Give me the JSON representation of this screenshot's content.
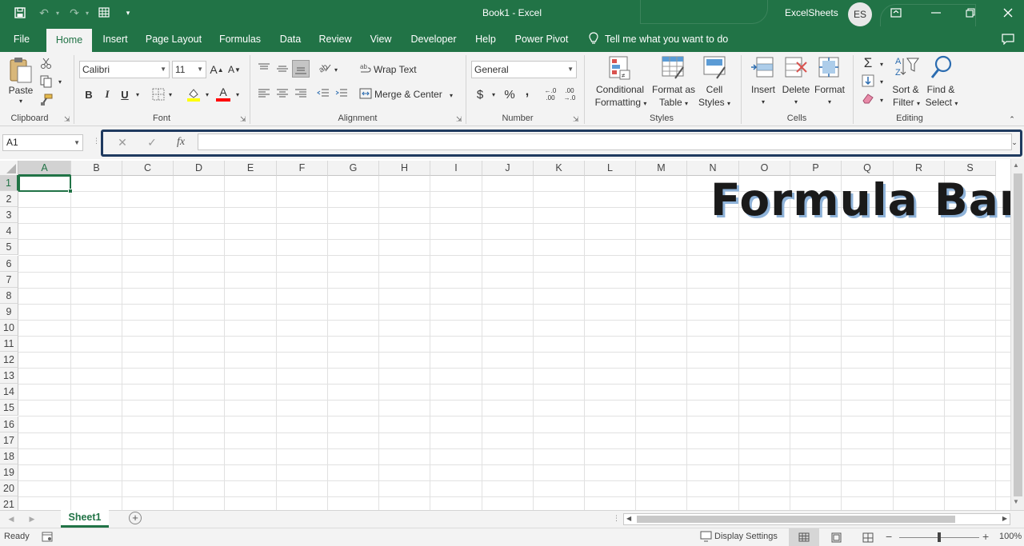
{
  "titlebar": {
    "title": "Book1  -  Excel",
    "user_name": "ExcelSheets",
    "user_initials": "ES"
  },
  "tabs": [
    "File",
    "Home",
    "Insert",
    "Page Layout",
    "Formulas",
    "Data",
    "Review",
    "View",
    "Developer",
    "Help",
    "Power Pivot"
  ],
  "tell_me": "Tell me what you want to do",
  "ribbon": {
    "clipboard": {
      "paste": "Paste",
      "label": "Clipboard"
    },
    "font": {
      "name": "Calibri",
      "size": "11",
      "bold": "B",
      "italic": "I",
      "underline": "U",
      "grow": "A",
      "shrink": "A",
      "color_letter": "A",
      "label": "Font"
    },
    "alignment": {
      "wrap_text": "Wrap Text",
      "merge_center": "Merge & Center",
      "label": "Alignment"
    },
    "number": {
      "format": "General",
      "currency": "$",
      "percent": "%",
      "comma": ",",
      "inc_decimal": "←.0 .00",
      "dec_decimal": ".00 →.0",
      "label": "Number"
    },
    "styles": {
      "conditional_1": "Conditional",
      "conditional_2": "Formatting",
      "format_table_1": "Format as",
      "format_table_2": "Table",
      "cell_styles_1": "Cell",
      "cell_styles_2": "Styles",
      "label": "Styles"
    },
    "cells": {
      "insert": "Insert",
      "delete": "Delete",
      "format": "Format",
      "label": "Cells"
    },
    "editing": {
      "sigma": "Σ",
      "sort_1": "Sort &",
      "sort_2": "Filter",
      "find_1": "Find &",
      "find_2": "Select",
      "label": "Editing"
    }
  },
  "formula_bar": {
    "name_box": "A1",
    "cancel": "✕",
    "enter": "✓",
    "fx": "fx",
    "value": ""
  },
  "grid": {
    "columns": [
      "A",
      "B",
      "C",
      "D",
      "E",
      "F",
      "G",
      "H",
      "I",
      "J",
      "K",
      "L",
      "M",
      "N",
      "O",
      "P",
      "Q",
      "R",
      "S"
    ],
    "rows": [
      "1",
      "2",
      "3",
      "4",
      "5",
      "6",
      "7",
      "8",
      "9",
      "10",
      "11",
      "12",
      "13",
      "14",
      "15",
      "16",
      "17",
      "18",
      "19",
      "20",
      "21"
    ],
    "selected_cell": "A1"
  },
  "overlay_text": "Formula Bar",
  "sheets": {
    "active": "Sheet1",
    "add": "+"
  },
  "status": {
    "ready": "Ready",
    "display_settings": "Display Settings",
    "zoom": "100%"
  },
  "colors": {
    "accent": "#217346",
    "highlight_border": "#1f3a5f",
    "fill_color": "#ffff00",
    "font_color": "#ff0000"
  }
}
